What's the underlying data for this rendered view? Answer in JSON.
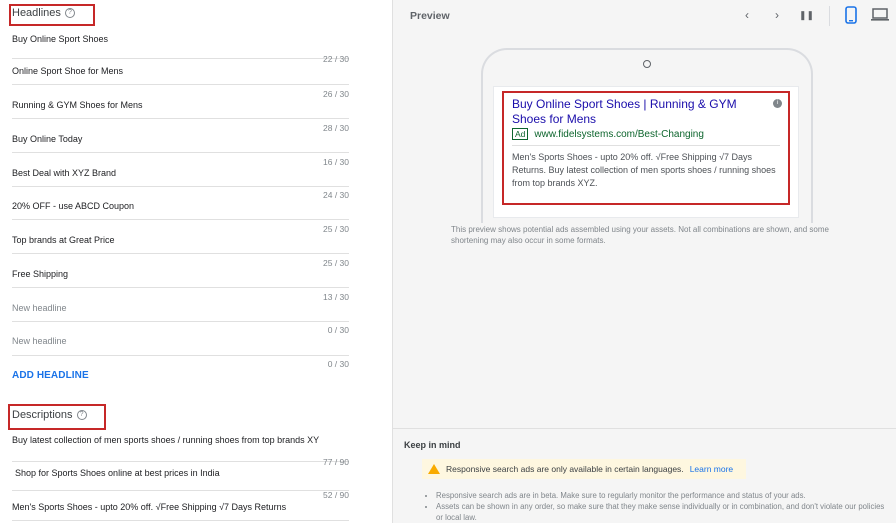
{
  "headlines": {
    "title": "Headlines",
    "items": [
      {
        "text": "Buy Online Sport Shoes",
        "counter": "22 / 30"
      },
      {
        "text": "Online Sport Shoe for Mens",
        "counter": "26 / 30"
      },
      {
        "text": "Running & GYM Shoes for Mens",
        "counter": "28 / 30"
      },
      {
        "text": "Buy Online Today",
        "counter": "16 / 30"
      },
      {
        "text": "Best Deal with XYZ Brand",
        "counter": "24 / 30"
      },
      {
        "text": "20% OFF - use ABCD Coupon",
        "counter": "25 / 30"
      },
      {
        "text": "Top brands at Great Price",
        "counter": "25 / 30"
      },
      {
        "text": "Free Shipping",
        "counter": "13 / 30"
      },
      {
        "placeholder": "New headline",
        "counter": "0 / 30"
      },
      {
        "placeholder": "New headline",
        "counter": "0 / 30"
      }
    ],
    "add_label": "ADD HEADLINE"
  },
  "descriptions": {
    "title": "Descriptions",
    "items": [
      {
        "text": "Buy latest collection of men sports shoes / running shoes from top brands XY",
        "counter": "77 / 90"
      },
      {
        "text": "Shop for Sports Shoes online at best prices in India",
        "counter": "52 / 90"
      },
      {
        "text": "Men's Sports Shoes - upto 20% off. √Free Shipping √7 Days Returns",
        "counter": ""
      }
    ]
  },
  "preview": {
    "title": "Preview",
    "nav": {
      "prev": "‹",
      "next": "›",
      "pause": "❚❚"
    },
    "ad": {
      "headline": "Buy Online Sport Shoes | Running & GYM Shoes for Mens",
      "badge": "Ad",
      "url": "www.fidelsystems.com/Best-Changing",
      "description": "Men's Sports Shoes - upto 20% off. √Free Shipping √7 Days Returns. Buy latest collection of men sports shoes / running shoes from top brands XYZ."
    },
    "note": "This preview shows potential ads assembled using your assets. Not all combinations are shown, and some shortening may also occur in some formats."
  },
  "keep_in_mind": {
    "title": "Keep in mind",
    "warning": "Responsive search ads are only available in certain languages.",
    "warning_link": "Learn more",
    "bullets": [
      "Responsive search ads are in beta. Make sure to regularly monitor the performance and status of your ads.",
      "Assets can be shown in any order, so make sure that they make sense individually or in combination, and don't violate our policies or local law."
    ]
  },
  "colors": {
    "accent": "#1a73e8",
    "highlight": "#c62828",
    "ad_url": "#0d652d",
    "ad_headline": "#1a0dab"
  }
}
